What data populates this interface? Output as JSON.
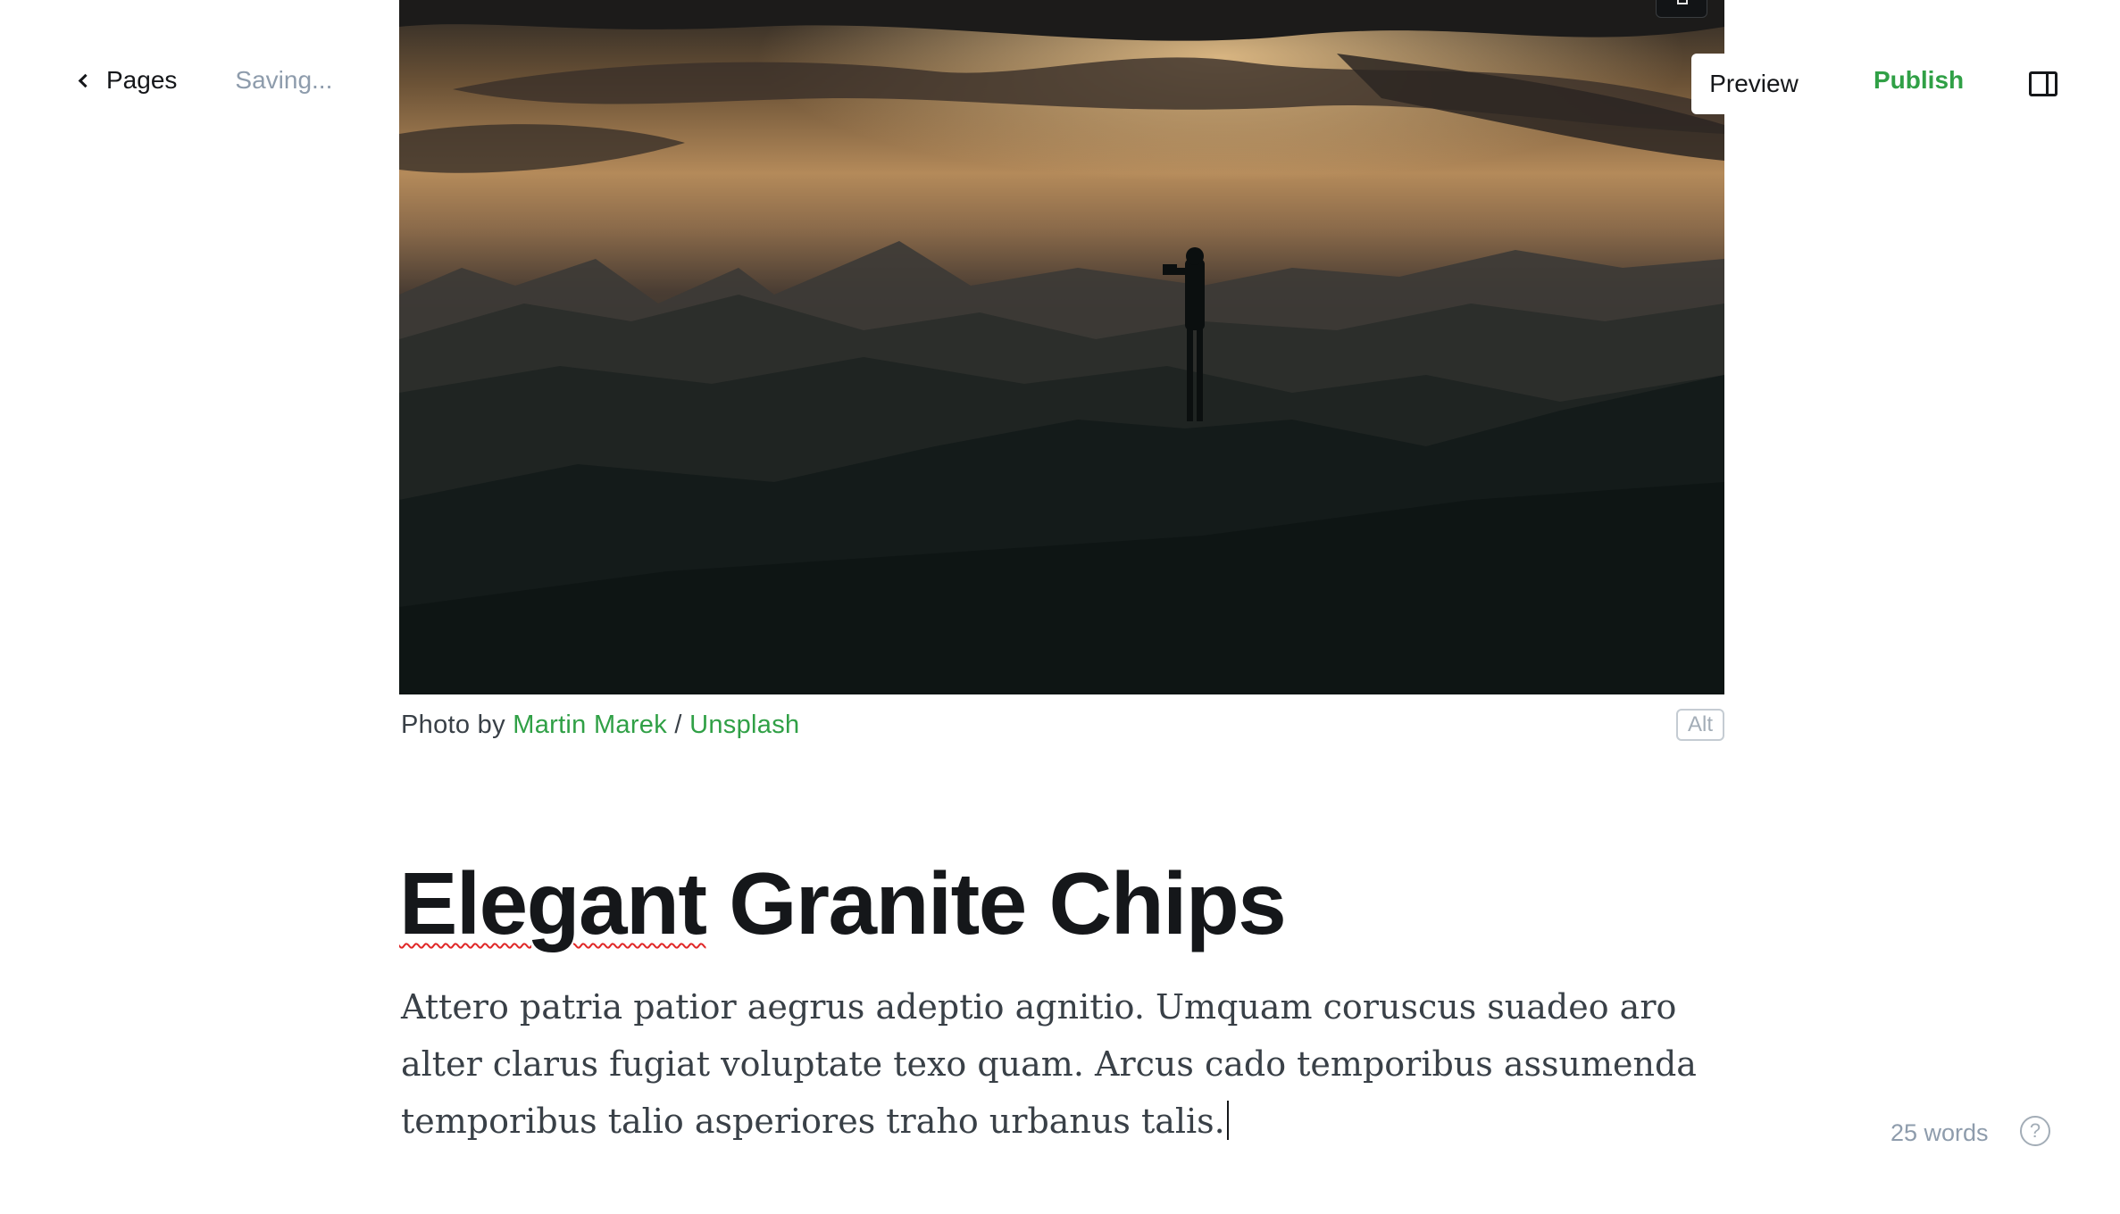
{
  "header": {
    "back_label": "Pages",
    "status": "Saving...",
    "preview_label": "Preview",
    "publish_label": "Publish"
  },
  "feature_image": {
    "caption_prefix": "Photo by ",
    "author": "Martin Marek",
    "separator": " / ",
    "source": "Unsplash",
    "alt_label": "Alt"
  },
  "post": {
    "title_part1": "Elegant",
    "title_part2": " Granite Chips",
    "body": "Attero patria patior aegrus adeptio agnitio. Umquam coruscus suadeo aro alter clarus fugiat voluptate texo quam. Arcus cado temporibus assumenda temporibus talio asperiores traho urbanus talis."
  },
  "footer": {
    "word_count": "25 words",
    "help_glyph": "?"
  },
  "colors": {
    "accent": "#30a046",
    "text": "#15171a",
    "muted": "#8e9cac"
  }
}
